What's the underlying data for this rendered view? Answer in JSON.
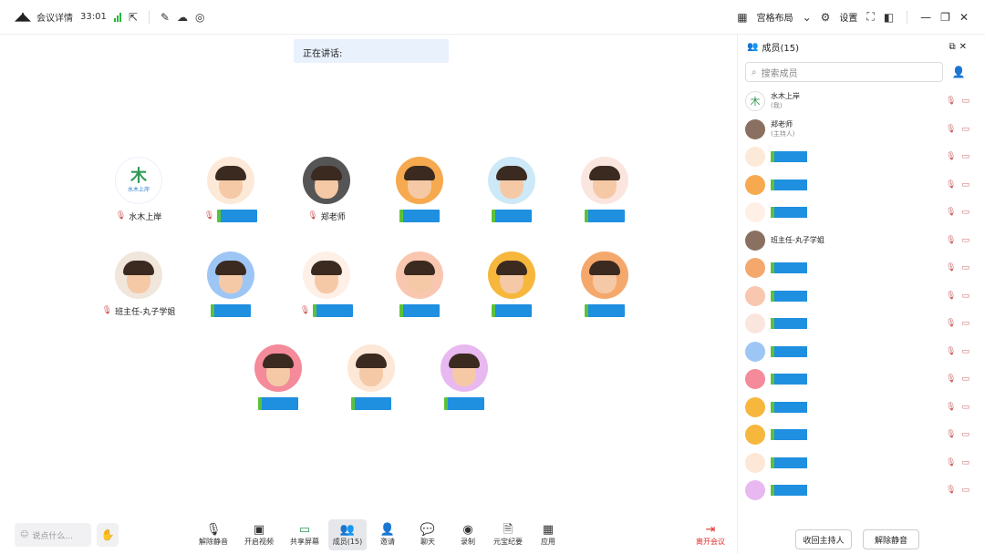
{
  "topbar": {
    "logo": "◢◣",
    "meeting_detail": "会议详情",
    "timer": "33:01",
    "layout_label": "宫格布局",
    "settings_label": "设置",
    "layout_icon": "grid-icon",
    "settings_icon": "gear-icon"
  },
  "stage": {
    "speaking_label": "正在讲话:",
    "participants": [
      {
        "id": "p1",
        "name": "水木上岸",
        "muted": true,
        "kind": "logo"
      },
      {
        "id": "p2",
        "name": "",
        "muted": true,
        "kind": "blur",
        "bg": "#fde9d8"
      },
      {
        "id": "p3",
        "name": "郑老师",
        "muted": true,
        "kind": "photo",
        "bg": "#555"
      },
      {
        "id": "p4",
        "name": "",
        "muted": false,
        "kind": "blur",
        "bg": "#f6a94e"
      },
      {
        "id": "p5",
        "name": "",
        "muted": false,
        "kind": "blur",
        "bg": "#cde9f7"
      },
      {
        "id": "p6",
        "name": "",
        "muted": false,
        "kind": "blur",
        "bg": "#fbe6df"
      },
      {
        "id": "p7",
        "name": "班主任-丸子学姐",
        "muted": true,
        "kind": "photo",
        "bg": "#f0e6dc"
      },
      {
        "id": "p8",
        "name": "",
        "muted": false,
        "kind": "blur",
        "bg": "#9ec6f5"
      },
      {
        "id": "p9",
        "name": "",
        "muted": true,
        "kind": "blur",
        "bg": "#fef0e6"
      },
      {
        "id": "p10",
        "name": "",
        "muted": false,
        "kind": "blur",
        "bg": "#f9c6b0"
      },
      {
        "id": "p11",
        "name": "",
        "muted": false,
        "kind": "blur",
        "bg": "#f6b73c"
      },
      {
        "id": "p12",
        "name": "",
        "muted": false,
        "kind": "blur",
        "bg": "#f5a86c"
      },
      {
        "id": "p13",
        "name": "",
        "muted": false,
        "kind": "blur",
        "bg": "#f48a9a"
      },
      {
        "id": "p14",
        "name": "",
        "muted": false,
        "kind": "blur",
        "bg": "#fde7d6"
      },
      {
        "id": "p15",
        "name": "",
        "muted": false,
        "kind": "blur",
        "bg": "#e8b8f0"
      }
    ]
  },
  "toolbar": {
    "say_placeholder": "说点什么...",
    "unmute": "解除静音",
    "start_video": "开启视频",
    "share_screen": "共享屏幕",
    "members": "成员(15)",
    "invite": "邀请",
    "chat": "聊天",
    "record": "录制",
    "yuanbao": "元宝纪要",
    "apps": "应用",
    "leave": "离开会议"
  },
  "sidebar": {
    "title": "成员(15)",
    "search_placeholder": "搜索成员",
    "members": [
      {
        "name": "水木上岸",
        "sub": "(我)",
        "kind": "logo"
      },
      {
        "name": "郑老师",
        "sub": "(主持人)",
        "kind": "photo"
      },
      {
        "name": "",
        "sub": "",
        "kind": "blur",
        "bg": "#fde9d8"
      },
      {
        "name": "",
        "sub": "",
        "kind": "blur",
        "bg": "#f6a94e"
      },
      {
        "name": "",
        "sub": "",
        "kind": "blur",
        "bg": "#fef0e6"
      },
      {
        "name": "班主任-丸子学姐",
        "sub": "",
        "kind": "photo"
      },
      {
        "name": "",
        "sub": "",
        "kind": "blur",
        "bg": "#f5a86c"
      },
      {
        "name": "",
        "sub": "",
        "kind": "blur",
        "bg": "#f9c6b0"
      },
      {
        "name": "",
        "sub": "",
        "kind": "blur",
        "bg": "#fbe6df"
      },
      {
        "name": "",
        "sub": "",
        "kind": "blur",
        "bg": "#9ec6f5"
      },
      {
        "name": "",
        "sub": "",
        "kind": "blur",
        "bg": "#f48a9a"
      },
      {
        "name": "",
        "sub": "",
        "kind": "blur",
        "bg": "#f6b73c"
      },
      {
        "name": "",
        "sub": "",
        "kind": "blur",
        "bg": "#f6b73c"
      },
      {
        "name": "",
        "sub": "",
        "kind": "blur",
        "bg": "#fde7d6"
      },
      {
        "name": "",
        "sub": "",
        "kind": "blur",
        "bg": "#e8b8f0"
      }
    ],
    "reclaim_host": "收回主持人",
    "unmute_all": "解除静音"
  }
}
